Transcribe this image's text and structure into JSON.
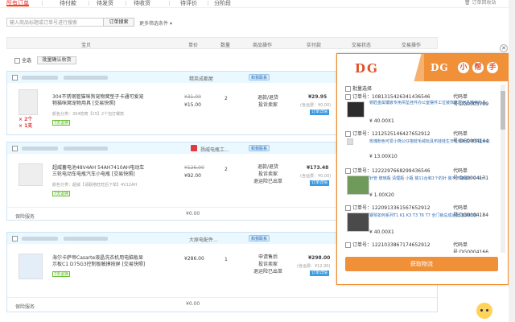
{
  "tabs": {
    "items": [
      "所有订单",
      "待付款",
      "待发货",
      "待收货",
      "待评价",
      "分阶段"
    ],
    "recycle_label": "订单回收站"
  },
  "search": {
    "placeholder": "输入商品标题或订单号进行搜索",
    "button_label": "订单搜索",
    "more_filter_label": "更多筛选条件"
  },
  "table_header": {
    "baby": "宝贝",
    "unit_price": "单价",
    "quantity": "数量",
    "after_sales": "商品操作",
    "paid": "实付款",
    "status": "交易状态",
    "actions": "交易操作"
  },
  "toolbar": {
    "select_all": "全选",
    "batch_confirm": "批量确认收货"
  },
  "orders": [
    {
      "shop": "精英成都屋",
      "chat": "和我联系",
      "product_title": "304不锈钢管猫咪狗宠物窝垫子卡通可爱宠物猫咪窝宠物用具 [交易快照]",
      "product_attr": "颜色分类：304管窝【15】2个包打螺款",
      "badge": "7天退换",
      "red_marks": [
        "× 2个",
        "× 1支"
      ],
      "orig_price": "¥31.00",
      "unit_price": "¥15.00",
      "qty": "2",
      "service": [
        "退款/退货",
        "投诉卖家"
      ],
      "paid": "¥29.95",
      "fee": "(含运费：¥0.00)",
      "status_detail": "订单详情"
    },
    {
      "shop": "扬威电瓶工...",
      "chat": "和我联系",
      "product_title": "超威蓄电池48V4AH 54AH7410AH电动车三轮电动车电瓶汽车小电瓶 [交易快照]",
      "product_attr": "颜色分类：超威【请联络旺旺后下单】4V12AH",
      "badge": "7天退换",
      "orig_price": "¥126.00",
      "unit_price": "¥92.00",
      "qty": "2",
      "service": [
        "退款/退货",
        "投诉卖家",
        "退运险已出单"
      ],
      "paid": "¥173.48",
      "fee": "(含运费：¥0.00)",
      "status_detail": "订单详情",
      "insurance": "保险服务",
      "insurance_price": "¥0.00"
    },
    {
      "shop": "大原电配件...",
      "chat": "和我联系",
      "product_title": "海尔卡萨帝Casarte液晶洗衣机用电脑板显示板C1 D75G3控制板触摸按屏 [交易快照]",
      "product_attr": "",
      "badge": "7天退换",
      "unit_price": "¥286.00",
      "qty": "1",
      "service": [
        "申请售后",
        "投诉卖家",
        "退运险已出单"
      ],
      "paid": "¥298.00",
      "fee": "(含运费：¥12.00)",
      "status_detail": "订单详情",
      "insurance": "保险服务",
      "insurance_price": "¥0.00"
    }
  ],
  "dg_panel": {
    "logo_left": "DG",
    "logo_right": "DG",
    "logo_chars": [
      "小",
      "帮",
      "手"
    ],
    "select_all": "批量选择",
    "orders": [
      {
        "no": "订单号：1081315426341436546",
        "code": "代码单号:DG0003709",
        "title": "钥匙金属镶嵌专用吊坠挂件办公室摆件工位装饰家居用品精美礼品",
        "price": "¥ 40.00X1"
      },
      {
        "no": "订单号：1212525146427652912",
        "code": "代码单号:DG0004144",
        "title": "玫瑰粉色可爱小熊公仔抱枕毛绒玩具布娃娃生日礼物女生可爱送女友",
        "price": "¥ 13.00X10"
      },
      {
        "no": "订单号：1222297668299436546",
        "code": "代码单号:DG0004171",
        "title": "针管 玻璃瓶 清理瓶 小瓶 装11台和1个的针 装不下吸收针 9.4cm",
        "price": "¥ 1.00X20"
      },
      {
        "no": "订单号：1220913361567652912",
        "code": "代码单号:DG0004184",
        "title": "钢琴如何系列T1 K1 K3 T3 T6 T7 全门锁总成适配 替换旧款",
        "price": "¥ 40.00X1"
      },
      {
        "no": "订单号：1221033867174652912",
        "code": "代码单号:DG0004166",
        "title": "",
        "price": ""
      }
    ],
    "button_label": "获取物流"
  }
}
